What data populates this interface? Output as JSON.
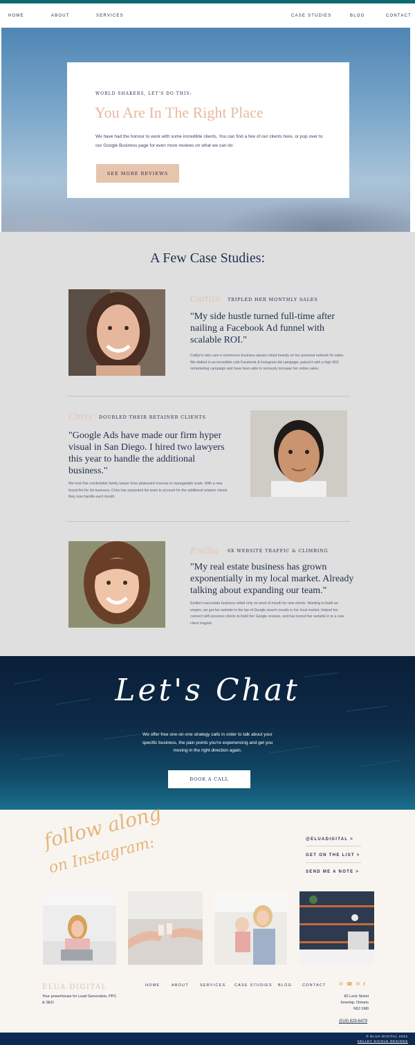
{
  "nav": {
    "home": "HOME",
    "about": "ABOUT",
    "services": "SERVICES",
    "case_studies": "CASE STUDIES",
    "blog": "BLOG",
    "contact": "CONTACT"
  },
  "hero": {
    "eyebrow": "WORLD SHAKERS, LET'S DO THIS:",
    "title": "You Are In The Right Place",
    "text": "We have had the honour to work with some incredible clients.  You can find a few of our clients here, or pop over to our Google Business page for even more reviews on what we can do",
    "button": "SEE MORE REVIEWS"
  },
  "cases": {
    "title": "A Few Case Studies:",
    "items": [
      {
        "name": "Caitlin",
        "tag": "TRIPLED HER MONTHLY SALES",
        "quote": "\"My side hustle turned full-time after nailing a Facebook Ad funnel with scalable ROI.\"",
        "text": "Caitlyn's skin care e-commerce business always relied heavily on her personal network for sales. We dialled in an incredible cold Facebook & Instagram Ad campaign, paired it with a high ROI remarketing campaign and have been able to seriously increase her online sales."
      },
      {
        "name": "Chris",
        "tag": "DOUBLED THEIR RETAINER CLIENTS",
        "quote": "\"Google Ads have made our firm hyper visual in San Diego. I hired two lawyers this year to handle the additional business.\"",
        "text": "We took this comfortable family lawyer from plateaued revenue to manageable scale. With a new found fire for his business, Chris has expanded his team to account for the additional retainer clients they now handle each month."
      },
      {
        "name": "Emilia",
        "tag": "6X WEBSITE TRAFFIC & CLIMBING",
        "quote": "\"My real estate business has grown exponentially in my local market. Already talking about expanding our team.\"",
        "text": "Emilia's real estate business relied only on word of mouth for new clients.  Wanting to build an empire, we got her website to the top of Google search results in her local market, helped her connect with previous clients to build her Google reviews, and has turned her website in to a new client magnet."
      }
    ]
  },
  "chat": {
    "title": "Let's Chat",
    "text": "We offer free one-on-one strategy calls in order to talk about your specific business, the pain points you're experiencing and get you moving in the right direction again.",
    "button": "BOOK A CALL"
  },
  "instagram": {
    "heading_line1": "follow along",
    "heading_line2": "on Instagram:",
    "links": [
      "@ELUADIGITAL >",
      "GET ON THE LIST >",
      "SEND ME A NOTE >"
    ]
  },
  "footer": {
    "brand": "ELUA DIGITAL",
    "tagline": "Your powerhouse for Lead Generation, PPC & SEO",
    "nav": [
      "HOME",
      "ABOUT",
      "SERVICES",
      "CASE STUDIES",
      "BLOG",
      "CONTACT"
    ],
    "address_line1": "82 Lock Street",
    "address_line2": "Innerkip, Ontario",
    "address_line3": "N0J 1M0",
    "phone": "(519) 829-6479",
    "copyright": "© ELUA DIGITAL 2021",
    "credit": "KELLEY NICOLE DESIGNS",
    "social_icons": [
      "email-icon",
      "phone-icon",
      "email-icon",
      "facebook-icon"
    ]
  },
  "colors": {
    "navy": "#1f2d4d",
    "peach": "#e8b8a0",
    "teal_top": "#0d6a73",
    "gold": "#e5b57a"
  }
}
